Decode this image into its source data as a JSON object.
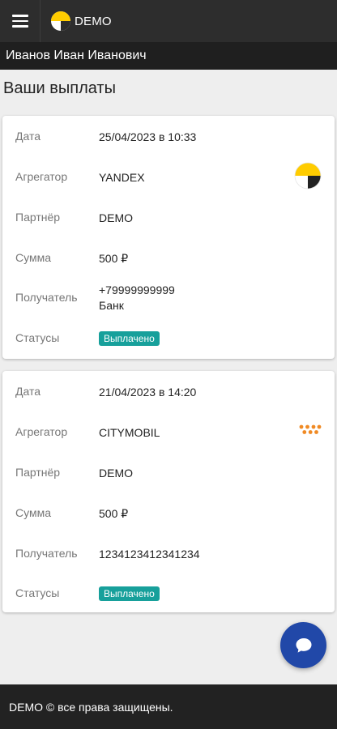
{
  "header": {
    "brand": "DEMO"
  },
  "user": {
    "name": "Иванов Иван Иванович"
  },
  "page": {
    "title": "Ваши выплаты"
  },
  "labels": {
    "date": "Дата",
    "aggregator": "Агрегатор",
    "partner": "Партнёр",
    "amount": "Сумма",
    "recipient": "Получатель",
    "statuses": "Статусы"
  },
  "payouts": [
    {
      "date": "25/04/2023 в 10:33",
      "aggregator": "YANDEX",
      "aggregator_icon": "yandex-logo-icon",
      "partner": "DEMO",
      "amount": "500 ₽",
      "recipient_line1": "+79999999999",
      "recipient_line2": "Банк",
      "status": "Выплачено"
    },
    {
      "date": "21/04/2023 в 14:20",
      "aggregator": "CITYMOBIL",
      "aggregator_icon": "citymobil-logo-icon",
      "partner": "DEMO",
      "amount": "500 ₽",
      "recipient_line1": "1234123412341234",
      "status": "Выплачено"
    }
  ],
  "footer": {
    "text": "DEMO © все права защищены."
  },
  "colors": {
    "topbar": "#2d2d2d",
    "userbar": "#1f1f1f",
    "status_badge": "#17a09b",
    "chat_button": "#2148a8",
    "yandex_yellow": "#ffcc00",
    "citymobil_orange": "#f08a24"
  }
}
